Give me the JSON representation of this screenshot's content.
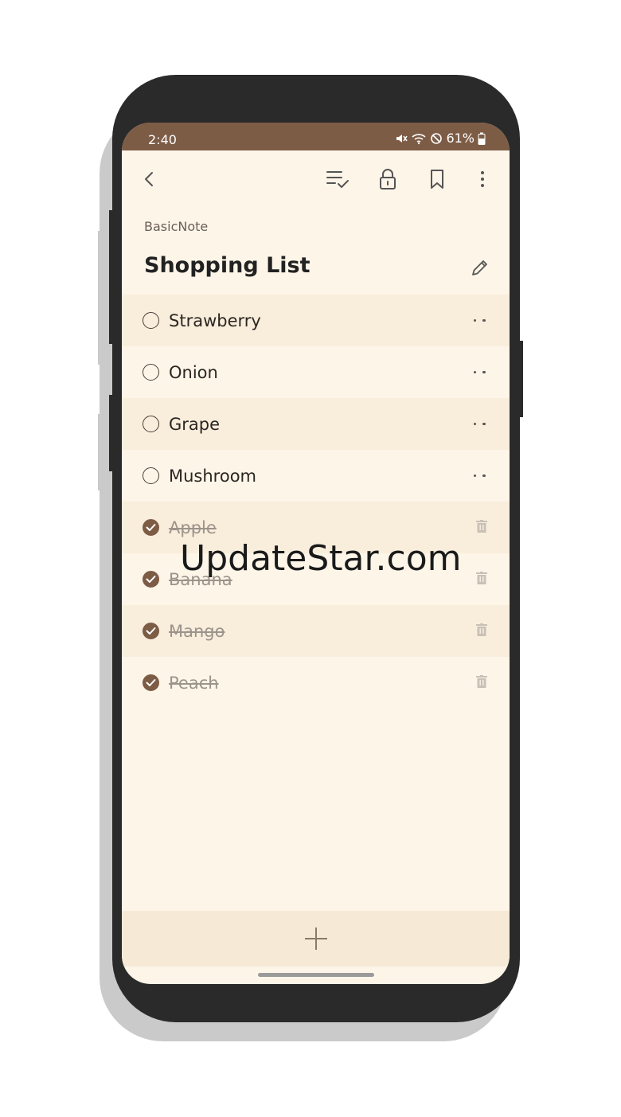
{
  "status": {
    "time": "2:40",
    "battery": "61%"
  },
  "toolbar": {
    "back_icon": "chevron-left-icon",
    "checklist_icon": "checklist-icon",
    "lock_icon": "lock-icon",
    "bookmark_icon": "bookmark-icon",
    "more_icon": "more-vertical-icon"
  },
  "note": {
    "app_name": "BasicNote",
    "title": "Shopping List"
  },
  "items": [
    {
      "label": "Strawberry",
      "checked": false
    },
    {
      "label": "Onion",
      "checked": false
    },
    {
      "label": "Grape",
      "checked": false
    },
    {
      "label": "Mushroom",
      "checked": false
    },
    {
      "label": "Apple",
      "checked": true
    },
    {
      "label": "Banana",
      "checked": true
    },
    {
      "label": "Mango",
      "checked": true
    },
    {
      "label": "Peach",
      "checked": true
    }
  ],
  "watermark": "UpdateStar.com",
  "colors": {
    "accent": "#7d5c46",
    "background": "#fdf5e8",
    "row_alt": "#f9eddc"
  }
}
